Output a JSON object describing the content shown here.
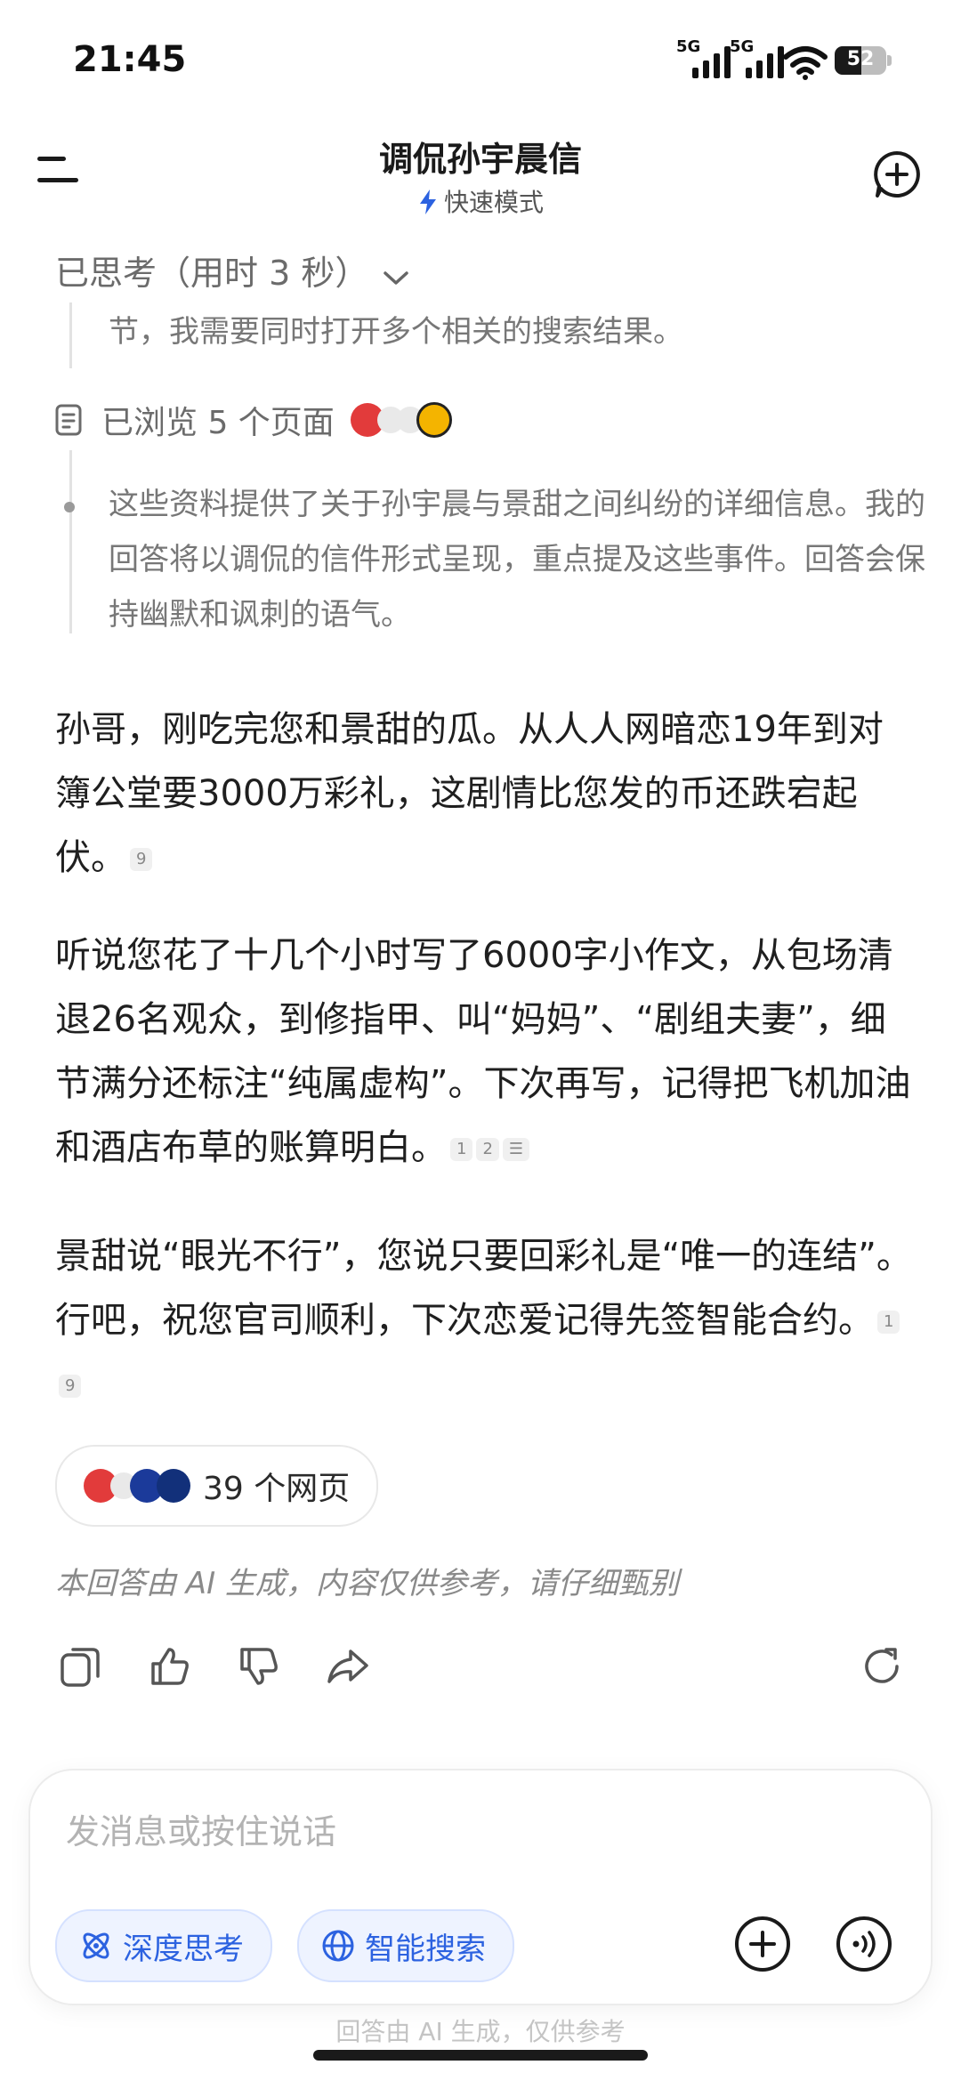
{
  "status_bar": {
    "time": "21:45",
    "signal1": "5G",
    "signal2": "5G",
    "battery": "52",
    "battery_percent": 52
  },
  "header": {
    "title": "调侃孙宇晨信",
    "mode": "快速模式"
  },
  "thinking": {
    "label": "已思考（用时 3 秒）",
    "step_text": "节，我需要同时打开多个相关的搜索结果。",
    "browsed": "已浏览 5 个页面",
    "summary": "这些资料提供了关于孙宇晨与景甜之间纠纷的详细信息。我的回答将以调侃的信件形式呈现，重点提及这些事件。回答会保持幽默和讽刺的语气。"
  },
  "answer": {
    "p1": "孙哥，刚吃完您和景甜的瓜。从人人网暗恋19年到对簿公堂要3000万彩礼，这剧情比您发的币还跌宕起伏。",
    "p1_cites": [
      "9"
    ],
    "p2": "听说您花了十几个小时写了6000字小作文，从包场清退26名观众，到修指甲、叫“妈妈”、“剧组夫妻”，细节满分还标注“纯属虚构”。下次再写，记得把飞机加油和酒店布草的账算明白。",
    "p2_cites": [
      "1",
      "2"
    ],
    "p3": "景甜说“眼光不行”，您说只要回彩礼是“唯一的连结”。行吧，祝您官司顺利，下次恋爱记得先签智能合约。",
    "p3_cites": [
      "1",
      "9"
    ]
  },
  "sources": {
    "label": "39 个网页"
  },
  "disclaimer": "本回答由 AI 生成，内容仅供参考，请仔细甄别",
  "input": {
    "placeholder": "发消息或按住说话",
    "deep_think": "深度思考",
    "smart_search": "智能搜索"
  },
  "footer_note": "回答由 AI 生成，仅供参考",
  "colors": {
    "accent": "#2c62e0",
    "chip_bg": "#eef3ff",
    "muted_text": "#777777"
  }
}
